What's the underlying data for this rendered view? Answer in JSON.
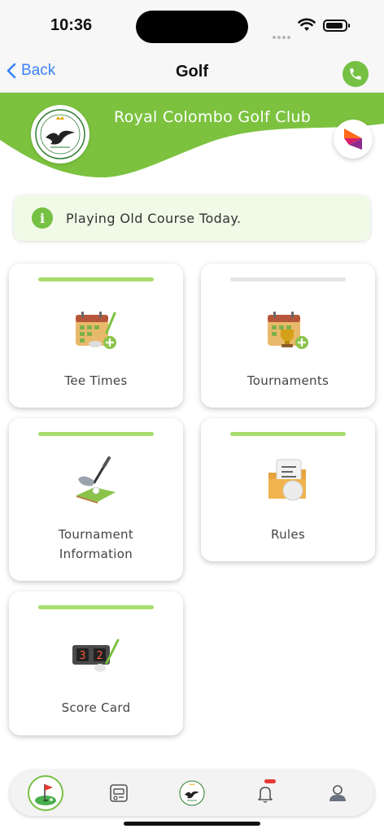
{
  "status_bar": {
    "time": "10:36"
  },
  "nav": {
    "back_label": "Back",
    "title": "Golf"
  },
  "header": {
    "club_name": "Royal Colombo Golf Club"
  },
  "notice": {
    "text": "Playing Old Course Today."
  },
  "tiles": [
    {
      "label": "Tee Times",
      "icon": "calendar-add-icon",
      "bar": "green"
    },
    {
      "label": "Tournaments",
      "icon": "calendar-trophy-icon",
      "bar": "grey"
    },
    {
      "label": "Tournament Information",
      "icon": "golf-club-ball-icon",
      "bar": "green"
    },
    {
      "label": "Rules",
      "icon": "folder-document-ball-icon",
      "bar": "green"
    },
    {
      "label": "Score Card",
      "icon": "scoreboard-icon",
      "bar": "green"
    }
  ],
  "colors": {
    "accent": "#76c043",
    "bar_green": "#a8dd6d",
    "link": "#3b82f6",
    "notice_bg": "#f0fae6"
  },
  "tab_bar": {
    "items": [
      {
        "icon": "golf-flag-icon",
        "active": true
      },
      {
        "icon": "booking-icon",
        "active": false
      },
      {
        "icon": "club-crest-icon",
        "active": false
      },
      {
        "icon": "notification-bell-icon",
        "active": false,
        "badge": true
      },
      {
        "icon": "profile-icon",
        "active": false
      }
    ]
  }
}
